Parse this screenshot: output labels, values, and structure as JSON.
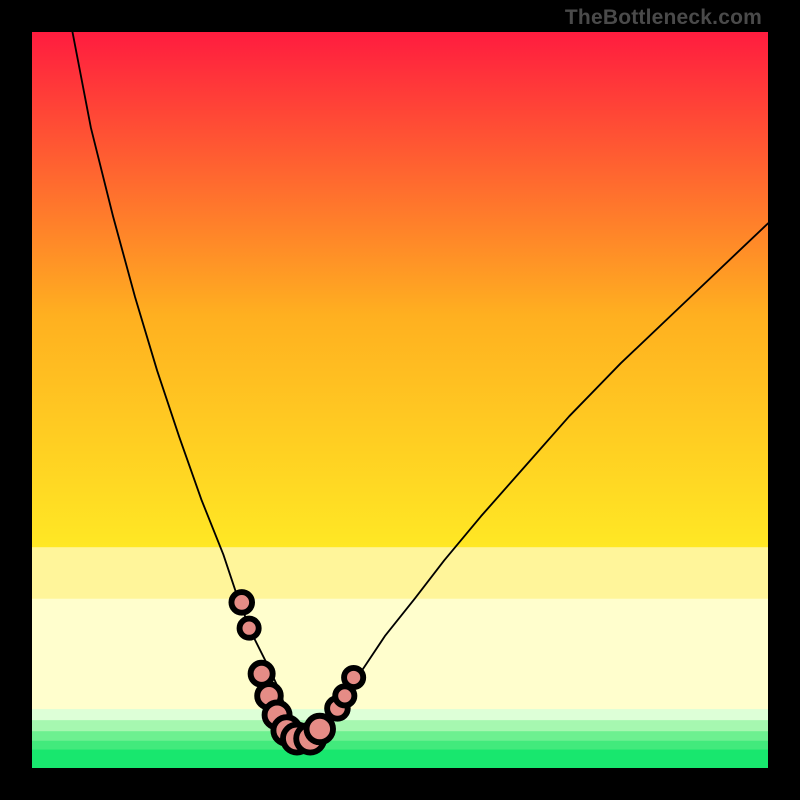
{
  "watermark": "TheBottleneck.com",
  "colors": {
    "red": "#ff1c3f",
    "orange": "#ff7a1f",
    "yellow": "#ffe824",
    "paleyellow": "#fffbb0",
    "cream": "#fcffe0",
    "green": "#18e76e",
    "curve": "#000000",
    "marker_fill": "#e58c86",
    "marker_stroke": "#8d4a44",
    "frame": "#000000"
  },
  "chart_data": {
    "type": "line",
    "title": "",
    "xlabel": "",
    "ylabel": "",
    "xlim": [
      0,
      100
    ],
    "ylim": [
      0,
      100
    ],
    "grid": false,
    "legend": false,
    "gradient_rows": [
      {
        "y0": 0,
        "y1": 70,
        "stops": [
          [
            0,
            "#ff1c3f"
          ],
          [
            55,
            "#ffb020"
          ],
          [
            100,
            "#ffe824"
          ]
        ]
      },
      {
        "y0": 70,
        "y1": 77,
        "color": "#fff59a"
      },
      {
        "y0": 77,
        "y1": 92,
        "color": "#fffecd"
      },
      {
        "y0": 92,
        "y1": 93.5,
        "color": "#ddffd7"
      },
      {
        "y0": 93.5,
        "y1": 95,
        "color": "#a6f7b0"
      },
      {
        "y0": 95,
        "y1": 96.3,
        "color": "#6df090"
      },
      {
        "y0": 96.3,
        "y1": 97.5,
        "color": "#42ea7c"
      },
      {
        "y0": 97.5,
        "y1": 100,
        "color": "#18e76e"
      }
    ],
    "series": [
      {
        "name": "bottleneck-curve",
        "x": [
          5.5,
          8,
          11,
          14,
          17,
          20,
          23,
          26,
          28,
          30,
          32,
          33.5,
          34.5,
          35.5,
          36.5,
          37.5,
          38.5,
          40.5,
          42.5,
          45,
          48,
          52,
          56,
          61,
          67,
          73,
          80,
          88,
          96,
          100
        ],
        "width": [
          3.6,
          3.5,
          3.4,
          3.2,
          3.0,
          2.8,
          2.6,
          2.4,
          2.25,
          2.1,
          2.0,
          1.9,
          1.8,
          1.7,
          1.7,
          1.7,
          1.8,
          1.9,
          2.0,
          2.1,
          2.2,
          2.3,
          2.4,
          2.55,
          2.7,
          2.85,
          3.0,
          3.15,
          3.3,
          3.4
        ],
        "y": [
          0,
          13,
          25,
          36,
          46,
          55,
          63.5,
          71,
          77,
          82,
          86,
          89.2,
          92,
          94.3,
          95.8,
          96.1,
          95.3,
          93.2,
          90.3,
          86.5,
          82,
          77,
          71.8,
          65.8,
          59,
          52.2,
          45,
          37.4,
          29.8,
          26
        ]
      }
    ],
    "markers": [
      {
        "x": 28.5,
        "y": 77.5,
        "r": 1.4
      },
      {
        "x": 29.5,
        "y": 81,
        "r": 1.3
      },
      {
        "x": 31.2,
        "y": 87.2,
        "r": 1.5
      },
      {
        "x": 32.2,
        "y": 90.2,
        "r": 1.6
      },
      {
        "x": 33.3,
        "y": 92.8,
        "r": 1.7
      },
      {
        "x": 34.6,
        "y": 94.9,
        "r": 1.8
      },
      {
        "x": 36.0,
        "y": 96.0,
        "r": 1.9
      },
      {
        "x": 37.8,
        "y": 96.0,
        "r": 1.9
      },
      {
        "x": 39.1,
        "y": 94.7,
        "r": 1.8
      },
      {
        "x": 41.5,
        "y": 91.9,
        "r": 1.4
      },
      {
        "x": 42.5,
        "y": 90.2,
        "r": 1.3
      },
      {
        "x": 43.7,
        "y": 87.7,
        "r": 1.3
      }
    ]
  }
}
